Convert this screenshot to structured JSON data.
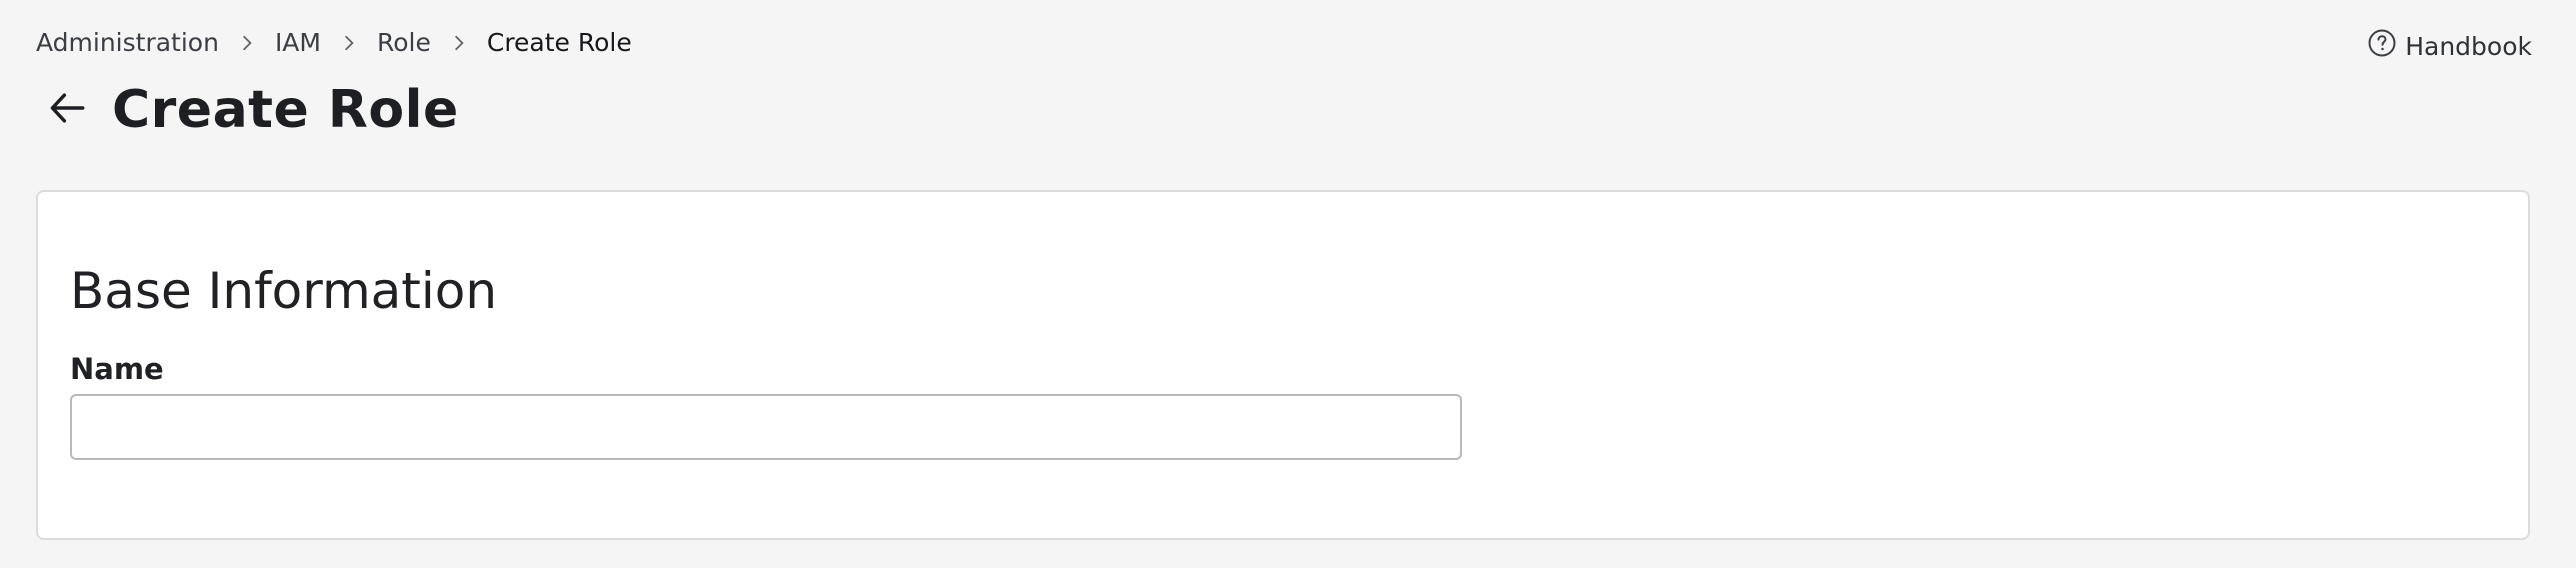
{
  "breadcrumb": {
    "items": [
      {
        "label": "Administration"
      },
      {
        "label": "IAM"
      },
      {
        "label": "Role"
      },
      {
        "label": "Create Role"
      }
    ]
  },
  "header": {
    "title": "Create Role",
    "back_icon": "arrow-left-icon",
    "handbook_label": "Handbook",
    "handbook_icon": "help-circle-icon"
  },
  "form": {
    "section_title": "Base Information",
    "name_label": "Name",
    "name_value": "",
    "name_placeholder": ""
  },
  "colors": {
    "background": "#f5f5f5",
    "card": "#ffffff",
    "card_border": "#dcdcdc",
    "input_border": "#b9b9b9",
    "text": "#202124"
  }
}
